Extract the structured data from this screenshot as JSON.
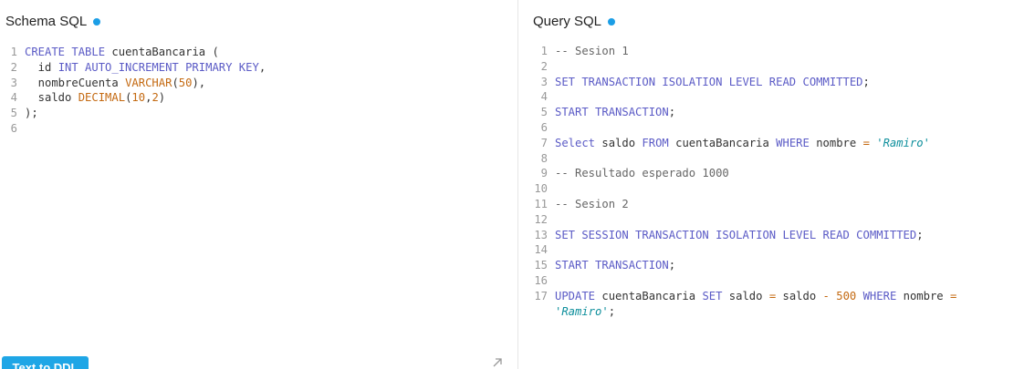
{
  "colors": {
    "keyword": "#5b5bc6",
    "type": "#c46a12",
    "number": "#c46a12",
    "string": "#0e8f9c",
    "operator": "#c46a12",
    "comment": "#666666",
    "plain": "#333333",
    "line_number": "#999999",
    "status_dot": "#1b9ee6",
    "button": "#1fa6e6"
  },
  "schema_panel": {
    "title": "Schema SQL",
    "button_label": "Text to DDL",
    "lines": [
      [
        [
          "kw",
          "CREATE TABLE"
        ],
        [
          "pl",
          " cuentaBancaria ("
        ]
      ],
      [
        [
          "pl",
          "  id "
        ],
        [
          "kw",
          "INT AUTO_INCREMENT PRIMARY KEY"
        ],
        [
          "pl",
          ","
        ]
      ],
      [
        [
          "pl",
          "  nombreCuenta "
        ],
        [
          "ty",
          "VARCHAR"
        ],
        [
          "pl",
          "("
        ],
        [
          "nu",
          "50"
        ],
        [
          "pl",
          "),"
        ]
      ],
      [
        [
          "pl",
          "  saldo "
        ],
        [
          "ty",
          "DECIMAL"
        ],
        [
          "pl",
          "("
        ],
        [
          "nu",
          "10"
        ],
        [
          "pl",
          ","
        ],
        [
          "nu",
          "2"
        ],
        [
          "pl",
          ")"
        ]
      ],
      [
        [
          "pl",
          ");"
        ]
      ],
      []
    ]
  },
  "query_panel": {
    "title": "Query SQL",
    "lines": [
      {
        "n": "1",
        "t": [
          [
            "cm",
            "-- Sesion 1"
          ]
        ]
      },
      {
        "n": "2",
        "t": []
      },
      {
        "n": "3",
        "t": [
          [
            "kw",
            "SET TRANSACTION ISOLATION LEVEL READ COMMITTED"
          ],
          [
            "pl",
            ";"
          ]
        ]
      },
      {
        "n": "4",
        "t": []
      },
      {
        "n": "5",
        "t": [
          [
            "kw",
            "START TRANSACTION"
          ],
          [
            "pl",
            ";"
          ]
        ]
      },
      {
        "n": "6",
        "t": []
      },
      {
        "n": "7",
        "t": [
          [
            "kw",
            "Select"
          ],
          [
            "pl",
            " saldo "
          ],
          [
            "kw",
            "FROM"
          ],
          [
            "pl",
            " cuentaBancaria "
          ],
          [
            "kw",
            "WHERE"
          ],
          [
            "pl",
            " nombre "
          ],
          [
            "op",
            "="
          ],
          [
            "pl",
            " "
          ],
          [
            "st",
            "'Ramiro'"
          ]
        ]
      },
      {
        "n": "8",
        "t": []
      },
      {
        "n": "9",
        "t": [
          [
            "cm",
            "-- Resultado esperado 1000"
          ]
        ]
      },
      {
        "n": "10",
        "t": []
      },
      {
        "n": "11",
        "t": [
          [
            "cm",
            "-- Sesion 2"
          ]
        ]
      },
      {
        "n": "12",
        "t": []
      },
      {
        "n": "13",
        "t": [
          [
            "kw",
            "SET SESSION TRANSACTION ISOLATION LEVEL READ COMMITTED"
          ],
          [
            "pl",
            ";"
          ]
        ]
      },
      {
        "n": "14",
        "t": []
      },
      {
        "n": "15",
        "t": [
          [
            "kw",
            "START TRANSACTION"
          ],
          [
            "pl",
            ";"
          ]
        ]
      },
      {
        "n": "16",
        "t": []
      },
      {
        "n": "17",
        "t": [
          [
            "kw",
            "UPDATE"
          ],
          [
            "pl",
            " cuentaBancaria "
          ],
          [
            "kw",
            "SET"
          ],
          [
            "pl",
            " saldo "
          ],
          [
            "op",
            "="
          ],
          [
            "pl",
            " saldo "
          ],
          [
            "op",
            "-"
          ],
          [
            "pl",
            " "
          ],
          [
            "nu",
            "500"
          ],
          [
            "pl",
            " "
          ],
          [
            "kw",
            "WHERE"
          ],
          [
            "pl",
            " nombre "
          ],
          [
            "op",
            "="
          ]
        ]
      },
      {
        "n": "",
        "t": [
          [
            "st",
            "'Ramiro'"
          ],
          [
            "pl",
            ";"
          ]
        ]
      }
    ]
  }
}
